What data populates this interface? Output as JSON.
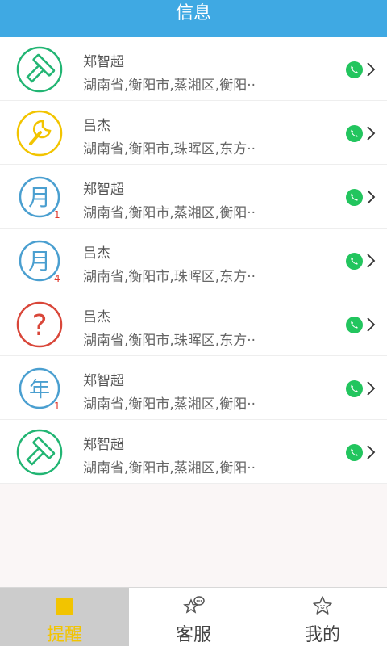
{
  "header": {
    "title": "信息"
  },
  "messages": [
    {
      "icon": "hammer-icon",
      "badge": "",
      "name": "郑智超",
      "address": "湖南省,衡阳市,蒸湘区,衡阳··",
      "action_icon": "phone-icon"
    },
    {
      "icon": "wrench-icon",
      "badge": "",
      "name": "吕杰",
      "address": "湖南省,衡阳市,珠晖区,东方··",
      "action_icon": "phone-icon"
    },
    {
      "icon": "month-icon",
      "icon_text": "月",
      "badge": "1",
      "name": "郑智超",
      "address": "湖南省,衡阳市,蒸湘区,衡阳··",
      "action_icon": "phone-icon"
    },
    {
      "icon": "month-icon",
      "icon_text": "月",
      "badge": "4",
      "name": "吕杰",
      "address": "湖南省,衡阳市,珠晖区,东方··",
      "action_icon": "phone-icon"
    },
    {
      "icon": "question-icon",
      "icon_text": "?",
      "badge": "",
      "name": "吕杰",
      "address": "湖南省,衡阳市,珠晖区,东方··",
      "action_icon": "phone-icon"
    },
    {
      "icon": "year-icon",
      "icon_text": "年",
      "badge": "1",
      "name": "郑智超",
      "address": "湖南省,衡阳市,蒸湘区,衡阳··",
      "action_icon": "phone-icon"
    },
    {
      "icon": "hammer-icon",
      "badge": "",
      "name": "郑智超",
      "address": "湖南省,衡阳市,蒸湘区,衡阳··",
      "action_icon": "phone-icon"
    }
  ],
  "tabbar": {
    "tabs": [
      {
        "label": "提醒",
        "icon": "reminder-icon",
        "active": true
      },
      {
        "label": "客服",
        "icon": "customer-service-icon",
        "active": false
      },
      {
        "label": "我的",
        "icon": "star-face-icon",
        "active": false
      }
    ]
  },
  "colors": {
    "header_bg": "#3fa9e3",
    "green": "#22b573",
    "yellow": "#f2c400",
    "blue": "#4a9fd0",
    "red": "#d9473a",
    "active_tab_bg": "#cccccc"
  }
}
